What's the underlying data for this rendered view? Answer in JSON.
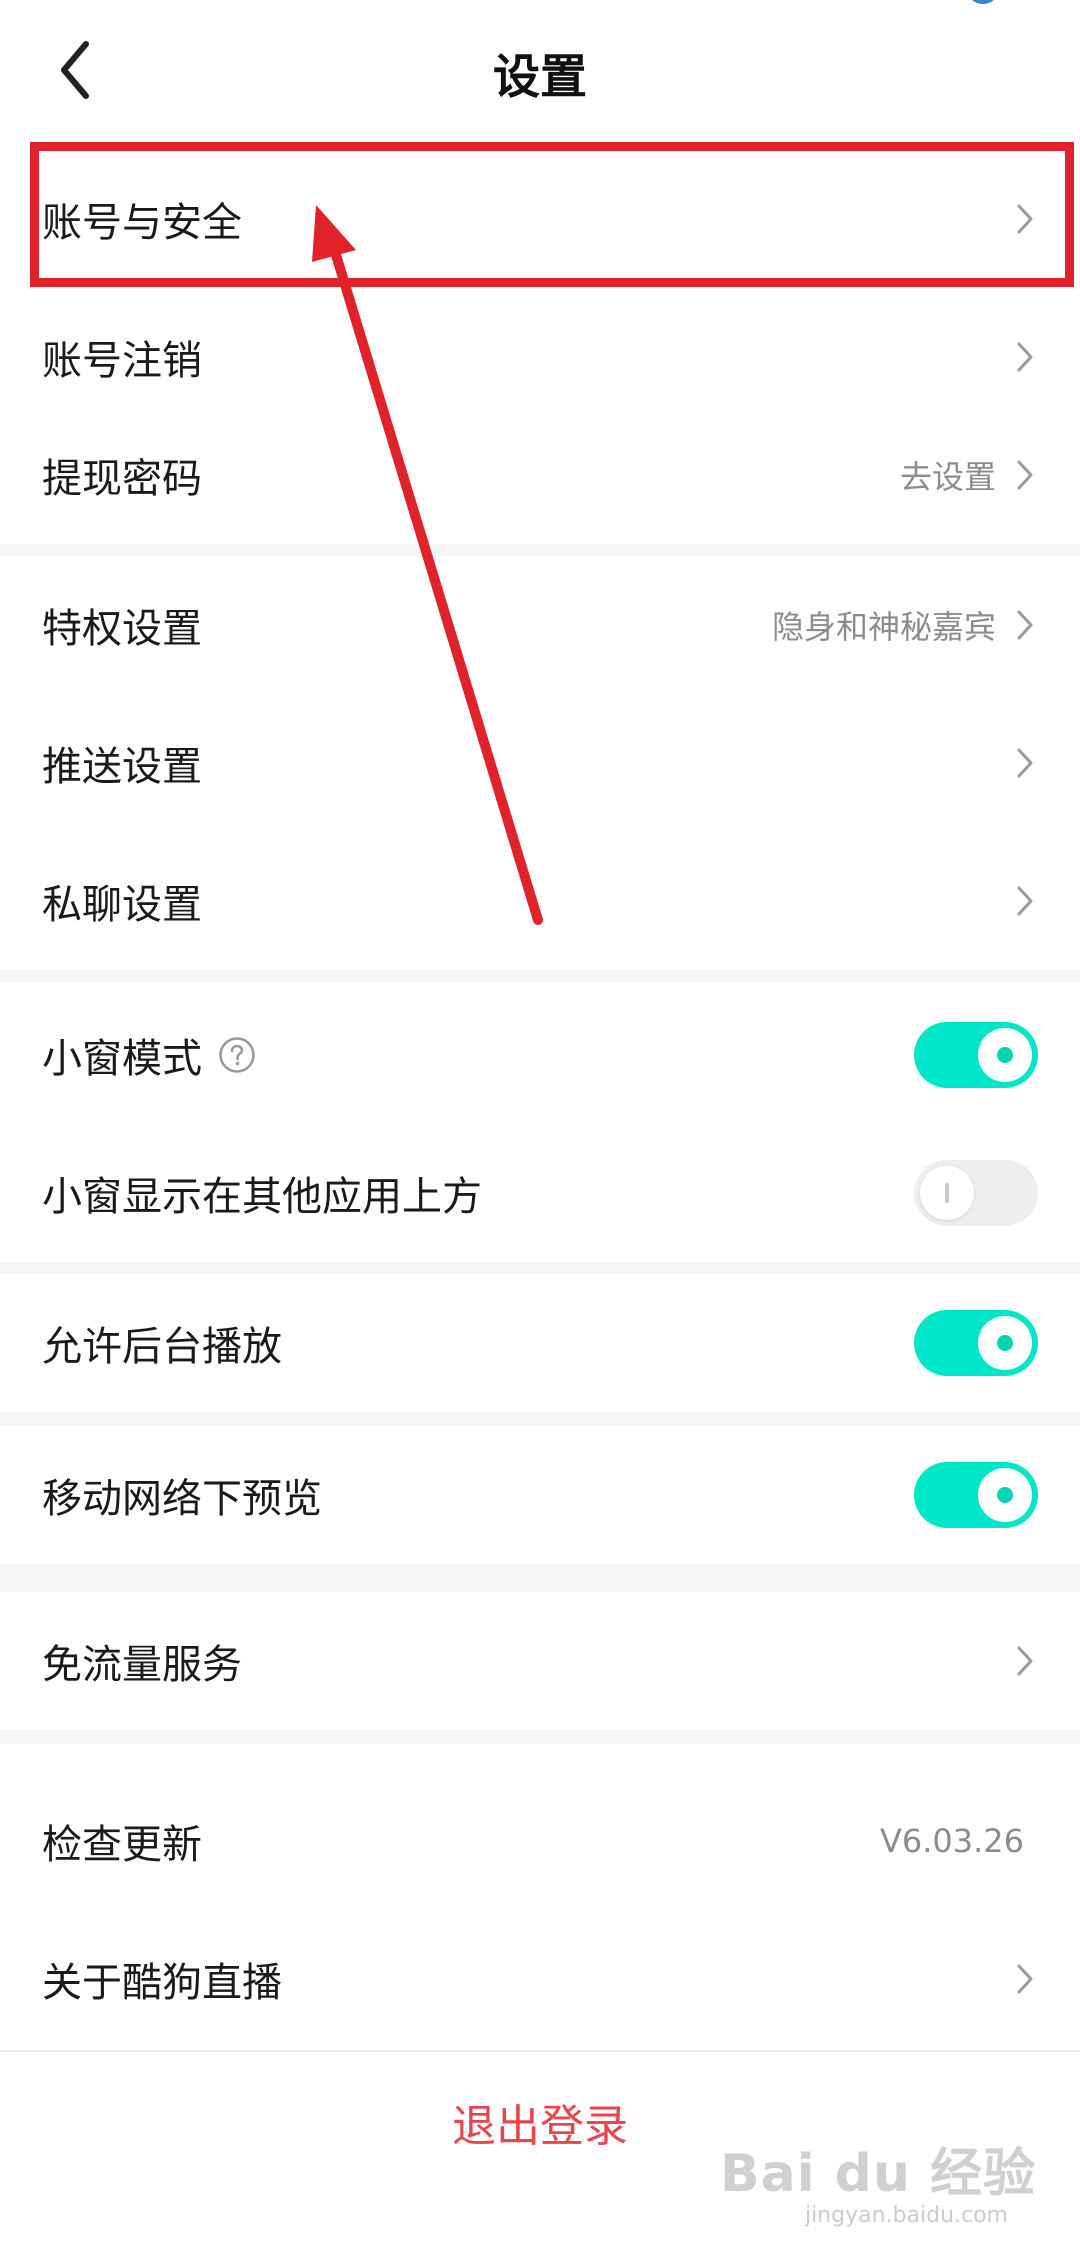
{
  "header": {
    "title": "设置",
    "back_icon": "chevron-left-icon"
  },
  "rows": {
    "account_security": {
      "label": "账号与安全"
    },
    "account_cancel": {
      "label": "账号注销"
    },
    "withdraw_password": {
      "label": "提现密码",
      "value": "去设置"
    },
    "privilege": {
      "label": "特权设置",
      "value": "隐身和神秘嘉宾"
    },
    "push": {
      "label": "推送设置"
    },
    "private_chat": {
      "label": "私聊设置"
    },
    "mini_window": {
      "label": "小窗模式",
      "enabled": true
    },
    "mini_window_overlay": {
      "label": "小窗显示在其他应用上方",
      "enabled": false
    },
    "background_play": {
      "label": "允许后台播放",
      "enabled": true
    },
    "mobile_preview": {
      "label": "移动网络下预览",
      "enabled": true
    },
    "free_data": {
      "label": "免流量服务"
    },
    "check_update": {
      "label": "检查更新",
      "value": "V6.03.26"
    },
    "about": {
      "label": "关于酷狗直播"
    }
  },
  "logout": {
    "label": "退出登录"
  },
  "watermark": {
    "logo": "Bai du 经验",
    "url": "jingyan.baidu.com"
  },
  "colors": {
    "toggle_on": "#00e6c8",
    "toggle_off": "#eeeeee",
    "logout_text": "#e8464d",
    "annotation": "#e0232b",
    "secondary_text": "#8c8c8c"
  }
}
